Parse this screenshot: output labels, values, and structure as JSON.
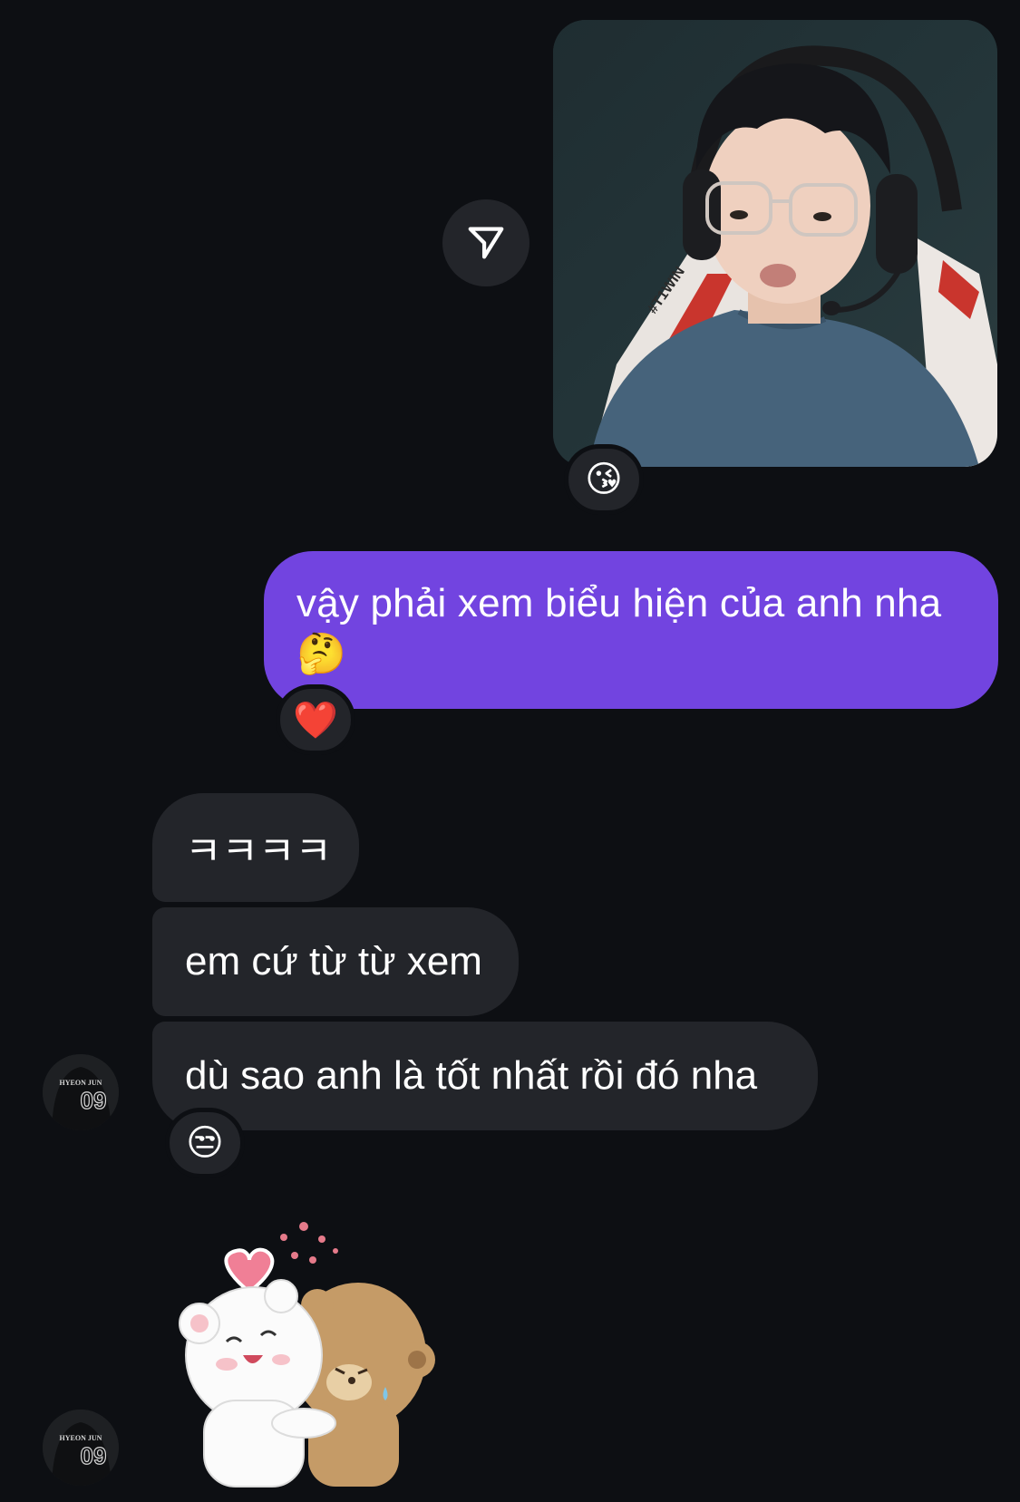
{
  "photo_message": {
    "jersey_text": "#T1WIN",
    "reaction_emoji": "😘"
  },
  "outgoing_message": {
    "text": "vậy phải xem biểu hiện của anh nha 🤔",
    "reaction_emoji": "❤️"
  },
  "incoming_messages": [
    {
      "text": "ㅋㅋㅋㅋ"
    },
    {
      "text": "em cứ từ từ xem"
    },
    {
      "text": "dù sao anh là tốt nhất rồi đó nha",
      "reaction_emoji": "😒"
    }
  ],
  "avatar": {
    "jersey_name": "HYEON JUN",
    "jersey_number": "09"
  },
  "icons": {
    "share": "send-paper-plane-icon",
    "sticker": "hugging-bears-sticker"
  },
  "colors": {
    "background": "#0d0f13",
    "outgoing_bubble": "#7244e0",
    "incoming_bubble": "#23252a"
  }
}
